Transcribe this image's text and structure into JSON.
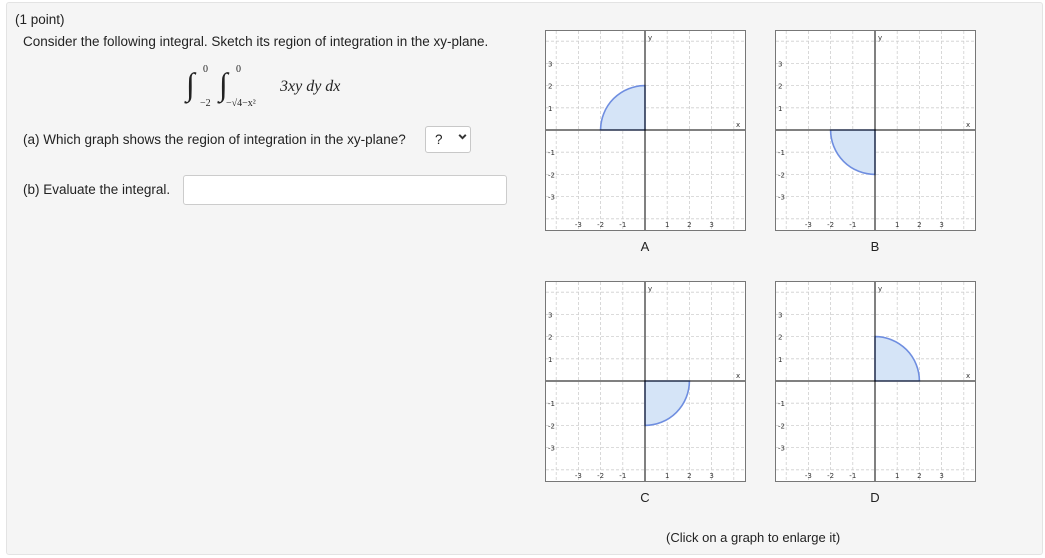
{
  "problem": {
    "points": "(1 point)",
    "prompt": "Consider the following integral. Sketch its region of integration in the xy-plane.",
    "integral": {
      "outer_lower": "−2",
      "outer_upper": "0",
      "inner_lower": "−√4−x²",
      "inner_upper": "0",
      "integrand": "3xy dy dx"
    },
    "part_a_label": "(a) Which graph shows the region of integration in the xy-plane?",
    "part_a_selected": "?",
    "part_b_label": "(b) Evaluate the integral.",
    "part_b_value": ""
  },
  "graphs": {
    "axis_x_name": "x",
    "axis_y_name": "y",
    "tick_labels_x": [
      "-3",
      "-2",
      "-1",
      "1",
      "2",
      "3"
    ],
    "tick_labels_y": [
      "3",
      "2",
      "1",
      "-1",
      "-2",
      "-3"
    ],
    "items": [
      {
        "label": "A",
        "quadrant": "second"
      },
      {
        "label": "B",
        "quadrant": "third"
      },
      {
        "label": "C",
        "quadrant": "fourth"
      },
      {
        "label": "D",
        "quadrant": "first"
      }
    ],
    "hint": "(Click on a graph to enlarge it)"
  },
  "colors": {
    "region_fill": "#d5e4f7",
    "region_stroke": "#6f8ee0",
    "grid": "#cfcfcf",
    "axis": "#000000"
  },
  "icons": {
    "dropdown": "chevron-down-icon"
  }
}
